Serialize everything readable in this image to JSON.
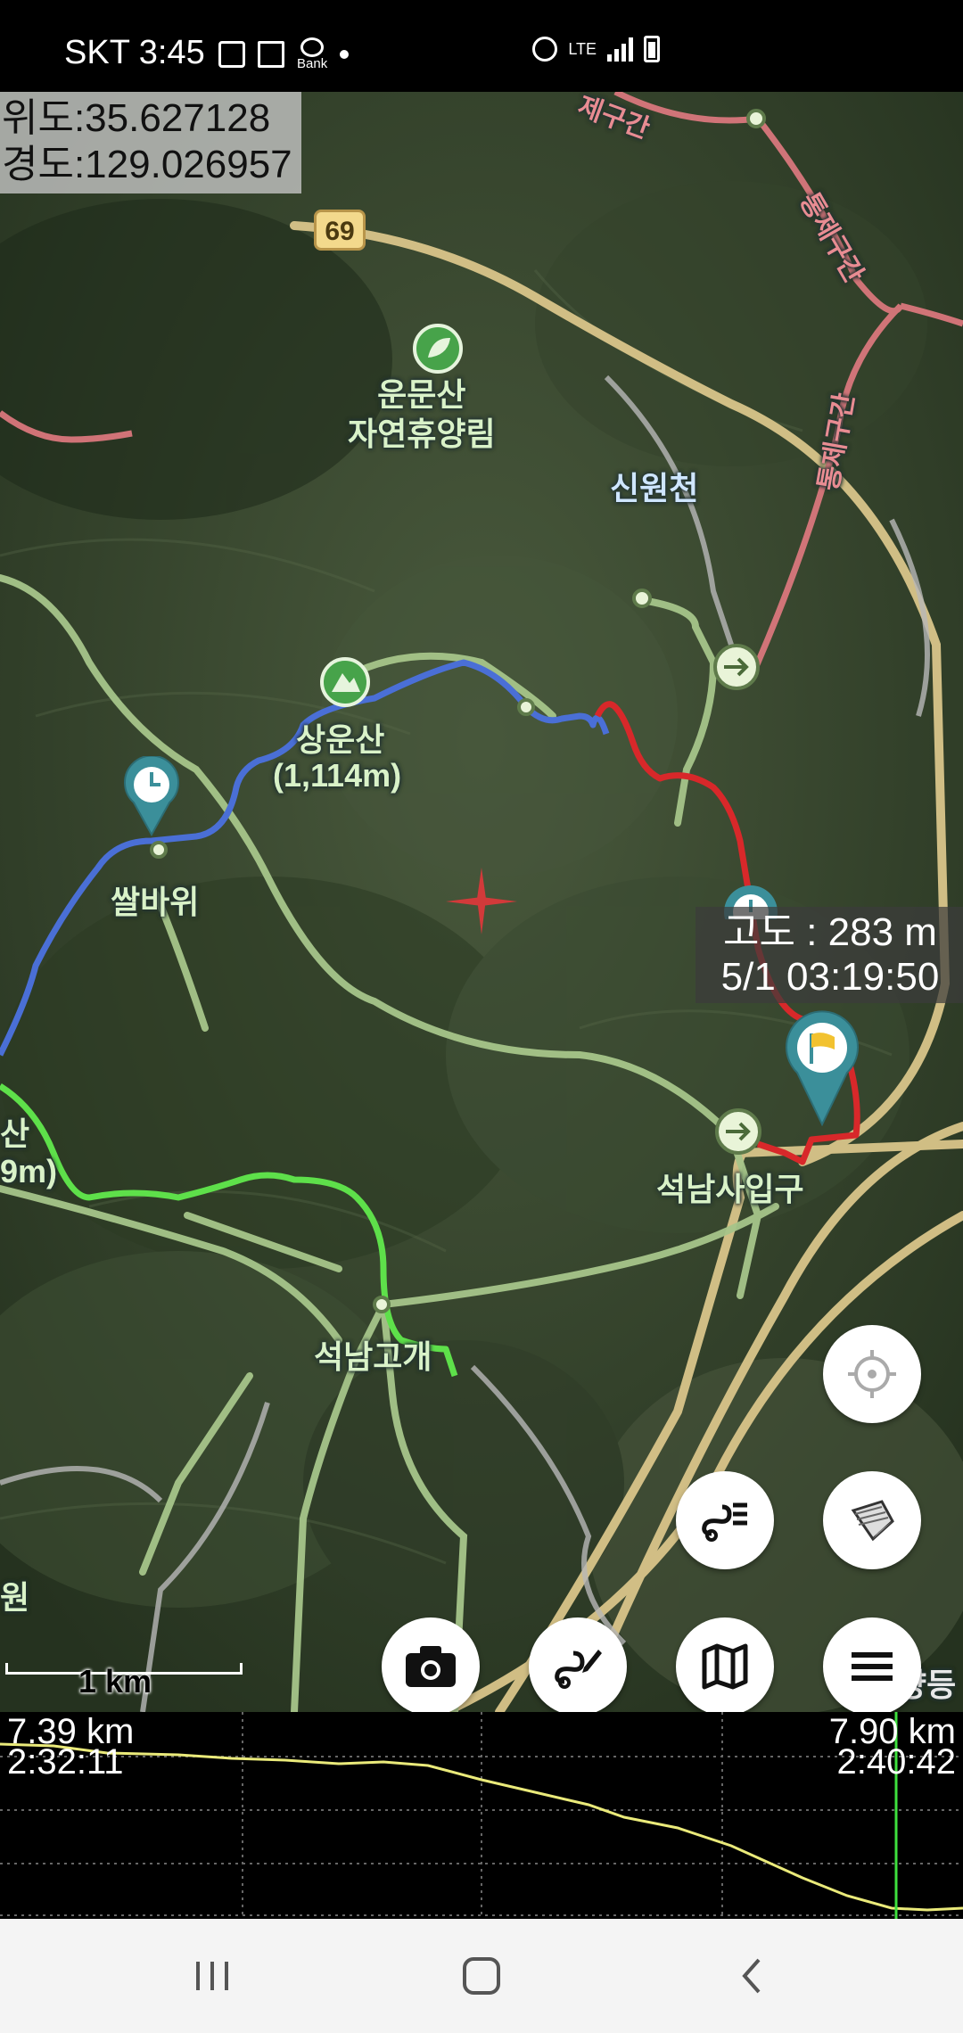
{
  "status_bar": {
    "time": "SKT 3:45",
    "bank_label": "Bank",
    "network_label": "LTE"
  },
  "map": {
    "coordinates": {
      "latitude": "위도:35.627128",
      "longitude": "경도:129.026957"
    },
    "road_number": "69",
    "labels": {
      "forest": "운문산\n자연휴양림",
      "stream": "신원천",
      "peak_name": "상운산",
      "peak_elevation": "(1,114m)",
      "rock": "쌀바위",
      "temple_entrance": "석남사입구",
      "pass": "석남고개",
      "restricted_1": "통제구간",
      "restricted_2": "통제구간",
      "left_peak_partial": "산",
      "left_elev_partial": "9m)",
      "bottom_right_partial": "양등",
      "left_bottom_partial": "원",
      "top_partial": "제구간"
    },
    "altitude_popup": {
      "altitude": "고도 : 283 m",
      "datetime": "5/1 03:19:50"
    },
    "scale": "1 km",
    "buttons": {
      "locate": "crosshair-icon",
      "layers": "layers-icon",
      "track_list": "track-list-icon",
      "camera": "camera-icon",
      "draw_route": "route-edit-icon",
      "map": "map-icon",
      "menu": "menu-icon"
    },
    "colors": {
      "blue_track": "#4a6fd6",
      "red_track": "#d8282a",
      "green_track": "#5ee04a",
      "trail": "#a6c58a",
      "road": "#d9c58a",
      "restricted": "#d9777c"
    }
  },
  "profile": {
    "left_distance": "7.39 km",
    "left_time": "2:32:11",
    "right_distance": "7.90 km",
    "right_time": "2:40:42"
  },
  "nav_bar": {
    "recent": "recents-icon",
    "home": "home-icon",
    "back": "back-icon"
  }
}
